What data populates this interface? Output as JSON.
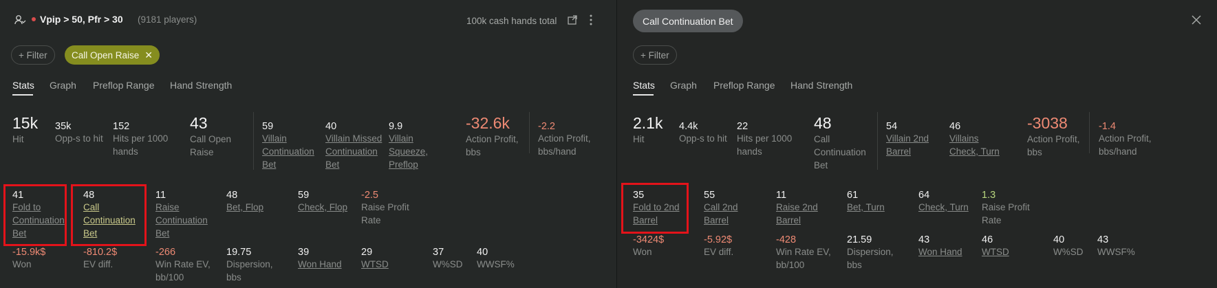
{
  "left": {
    "header": {
      "filter_label": "Vpip > 50, Pfr > 30",
      "players": "(9181 players)",
      "hands_total": "100k cash hands total"
    },
    "filter_button": "+ Filter",
    "active_filter": "Call Open Raise",
    "tabs": [
      "Stats",
      "Graph",
      "Preflop Range",
      "Hand Strength"
    ],
    "top_stats": [
      {
        "value": "15k",
        "label": "Hit"
      },
      {
        "value": "35k",
        "label": "Opp-s to hit"
      },
      {
        "value": "152",
        "label": "Hits per 1000 hands"
      },
      {
        "value": "43",
        "label": "Call Open Raise"
      },
      {
        "value": "59",
        "label": "Villain Continuation Bet"
      },
      {
        "value": "40",
        "label": "Villain Missed Continuation Bet"
      },
      {
        "value": "9.9",
        "label": "Villain Squeeze, Preflop"
      },
      {
        "value": "-32.6k",
        "label": "Action Profit, bbs"
      },
      {
        "value": "-2.2",
        "label": "Action Profit, bbs/hand"
      }
    ],
    "row2": [
      {
        "value": "41",
        "label": "Fold to Continuation Bet"
      },
      {
        "value": "48",
        "label": "Call Continuation Bet"
      },
      {
        "value": "11",
        "label": "Raise Continuation Bet"
      },
      {
        "value": "48",
        "label": "Bet, Flop"
      },
      {
        "value": "59",
        "label": "Check, Flop"
      },
      {
        "value": "-2.5",
        "label": "Raise Profit Rate"
      }
    ],
    "row3": [
      {
        "value": "-15.9k$",
        "label": "Won"
      },
      {
        "value": "-810.2$",
        "label": "EV diff."
      },
      {
        "value": "-266",
        "label": "Win Rate EV, bb/100"
      },
      {
        "value": "19.75",
        "label": "Dispersion, bbs"
      },
      {
        "value": "39",
        "label": "Won Hand"
      },
      {
        "value": "29",
        "label": "WTSD"
      },
      {
        "value": "37",
        "label": "W%SD"
      },
      {
        "value": "40",
        "label": "WWSF%"
      }
    ]
  },
  "right": {
    "title": "Call Continuation Bet",
    "filter_button": "+ Filter",
    "tabs": [
      "Stats",
      "Graph",
      "Preflop Range",
      "Hand Strength"
    ],
    "top_stats": [
      {
        "value": "2.1k",
        "label": "Hit"
      },
      {
        "value": "4.4k",
        "label": "Opp-s to hit"
      },
      {
        "value": "22",
        "label": "Hits per 1000 hands"
      },
      {
        "value": "48",
        "label": "Call Continuation Bet"
      },
      {
        "value": "54",
        "label": "Villain 2nd Barrel"
      },
      {
        "value": "46",
        "label": "Villains Check, Turn"
      },
      {
        "value": "-3038",
        "label": "Action Profit, bbs"
      },
      {
        "value": "-1.4",
        "label": "Action Profit, bbs/hand"
      }
    ],
    "row2": [
      {
        "value": "35",
        "label": "Fold to 2nd Barrel"
      },
      {
        "value": "55",
        "label": "Call 2nd Barrel"
      },
      {
        "value": "11",
        "label": "Raise 2nd Barrel"
      },
      {
        "value": "61",
        "label": "Bet, Turn"
      },
      {
        "value": "64",
        "label": "Check, Turn"
      },
      {
        "value": "1.3",
        "label": "Raise Profit Rate"
      }
    ],
    "row3": [
      {
        "value": "-3424$",
        "label": "Won"
      },
      {
        "value": "-5.92$",
        "label": "EV diff."
      },
      {
        "value": "-428",
        "label": "Win Rate EV, bb/100"
      },
      {
        "value": "21.59",
        "label": "Dispersion, bbs"
      },
      {
        "value": "43",
        "label": "Won Hand"
      },
      {
        "value": "46",
        "label": "WTSD"
      },
      {
        "value": "40",
        "label": "W%SD"
      },
      {
        "value": "43",
        "label": "WWSF%"
      }
    ]
  },
  "icons": {
    "user_filter": "user-filter-icon",
    "export": "export-icon",
    "more": "more-vertical-icon",
    "close": "close-icon"
  },
  "colors": {
    "negative": "#ee8a74",
    "positive": "#b8d67e",
    "accent_pill": "#858d1f",
    "highlight_box": "#e3131a"
  }
}
